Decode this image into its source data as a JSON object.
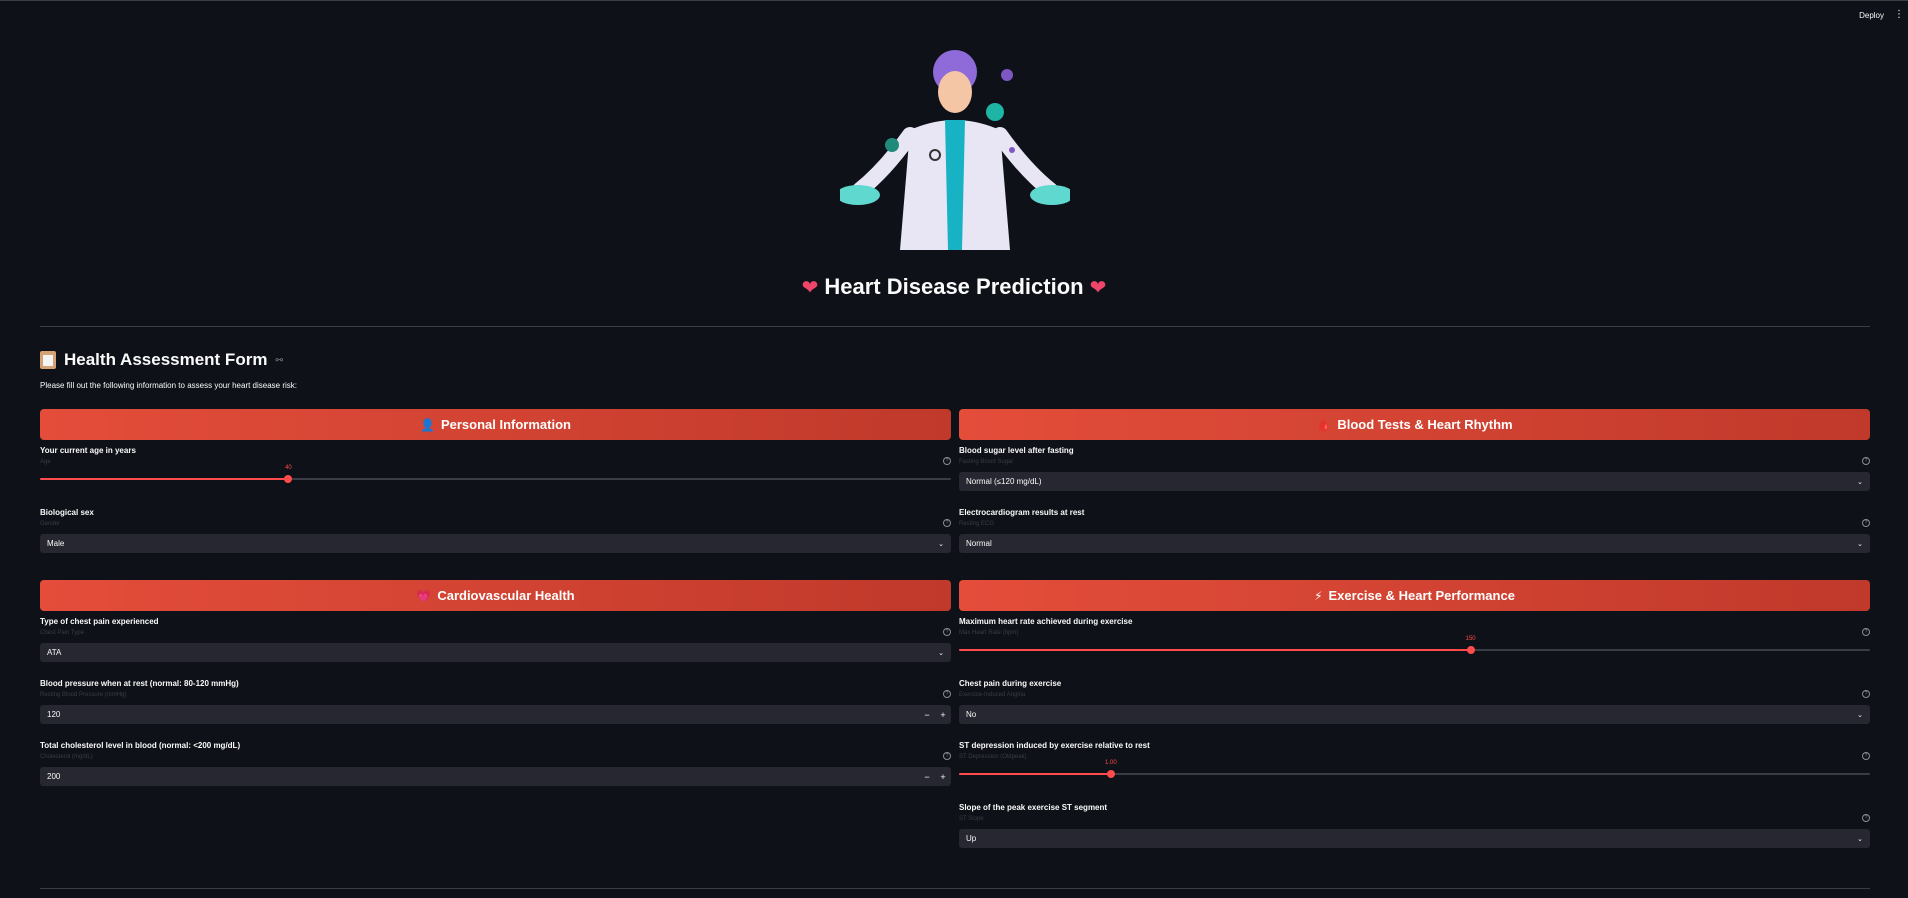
{
  "topbar": {
    "deploy_label": "Deploy",
    "menu_icon": "kebab-menu-icon"
  },
  "hero": {
    "image": "doctor-illustration"
  },
  "title": "Heart Disease Prediction",
  "form": {
    "title": "Health Assessment Form",
    "subtitle": "Please fill out the following information to assess your heart disease risk:"
  },
  "personal": {
    "heading": "Personal Information",
    "icon": "person-icon",
    "age": {
      "label": "Your current age in years",
      "help": "Age",
      "value": "40",
      "fraction": 0.2727
    },
    "sex": {
      "label": "Biological sex",
      "help": "Gender",
      "value": "Male"
    }
  },
  "blood": {
    "heading": "Blood Tests & Heart Rhythm",
    "icon": "test-tube-icon",
    "fasting": {
      "label": "Blood sugar level after fasting",
      "help": "Fasting Blood Sugar",
      "value": "Normal (≤120 mg/dL)"
    },
    "ecg": {
      "label": "Electrocardiogram results at rest",
      "help": "Resting ECG",
      "value": "Normal"
    }
  },
  "cardio": {
    "heading": "Cardiovascular Health",
    "icon": "heart-icon",
    "chest_pain": {
      "label": "Type of chest pain experienced",
      "help": "Chest Pain Type",
      "value": "ATA"
    },
    "bp": {
      "label": "Blood pressure when at rest (normal: 80-120 mmHg)",
      "help": "Resting Blood Pressure (mmHg)",
      "value": "120"
    },
    "chol": {
      "label": "Total cholesterol level in blood (normal: <200 mg/dL)",
      "help": "Cholesterol (mg/dL)",
      "value": "200"
    }
  },
  "exercise": {
    "heading": "Exercise & Heart Performance",
    "icon": "lightning-icon",
    "max_hr": {
      "label": "Maximum heart rate achieved during exercise",
      "help": "Max Heart Rate (bpm)",
      "value": "150",
      "fraction": 0.5616
    },
    "angina": {
      "label": "Chest pain during exercise",
      "help": "Exercise-Induced Angina",
      "value": "No"
    },
    "oldpeak": {
      "label": "ST depression induced by exercise relative to rest",
      "help": "ST Depression (Oldpeak)",
      "value": "1.00",
      "fraction": 0.1667
    },
    "slope": {
      "label": "Slope of the peak exercise ST segment",
      "help": "ST Slope",
      "value": "Up"
    }
  },
  "colors": {
    "accent": "#ff4b4b",
    "header_start": "#e44d3a",
    "header_end": "#c0392b",
    "background": "#0e1117",
    "input_bg": "#262730"
  }
}
